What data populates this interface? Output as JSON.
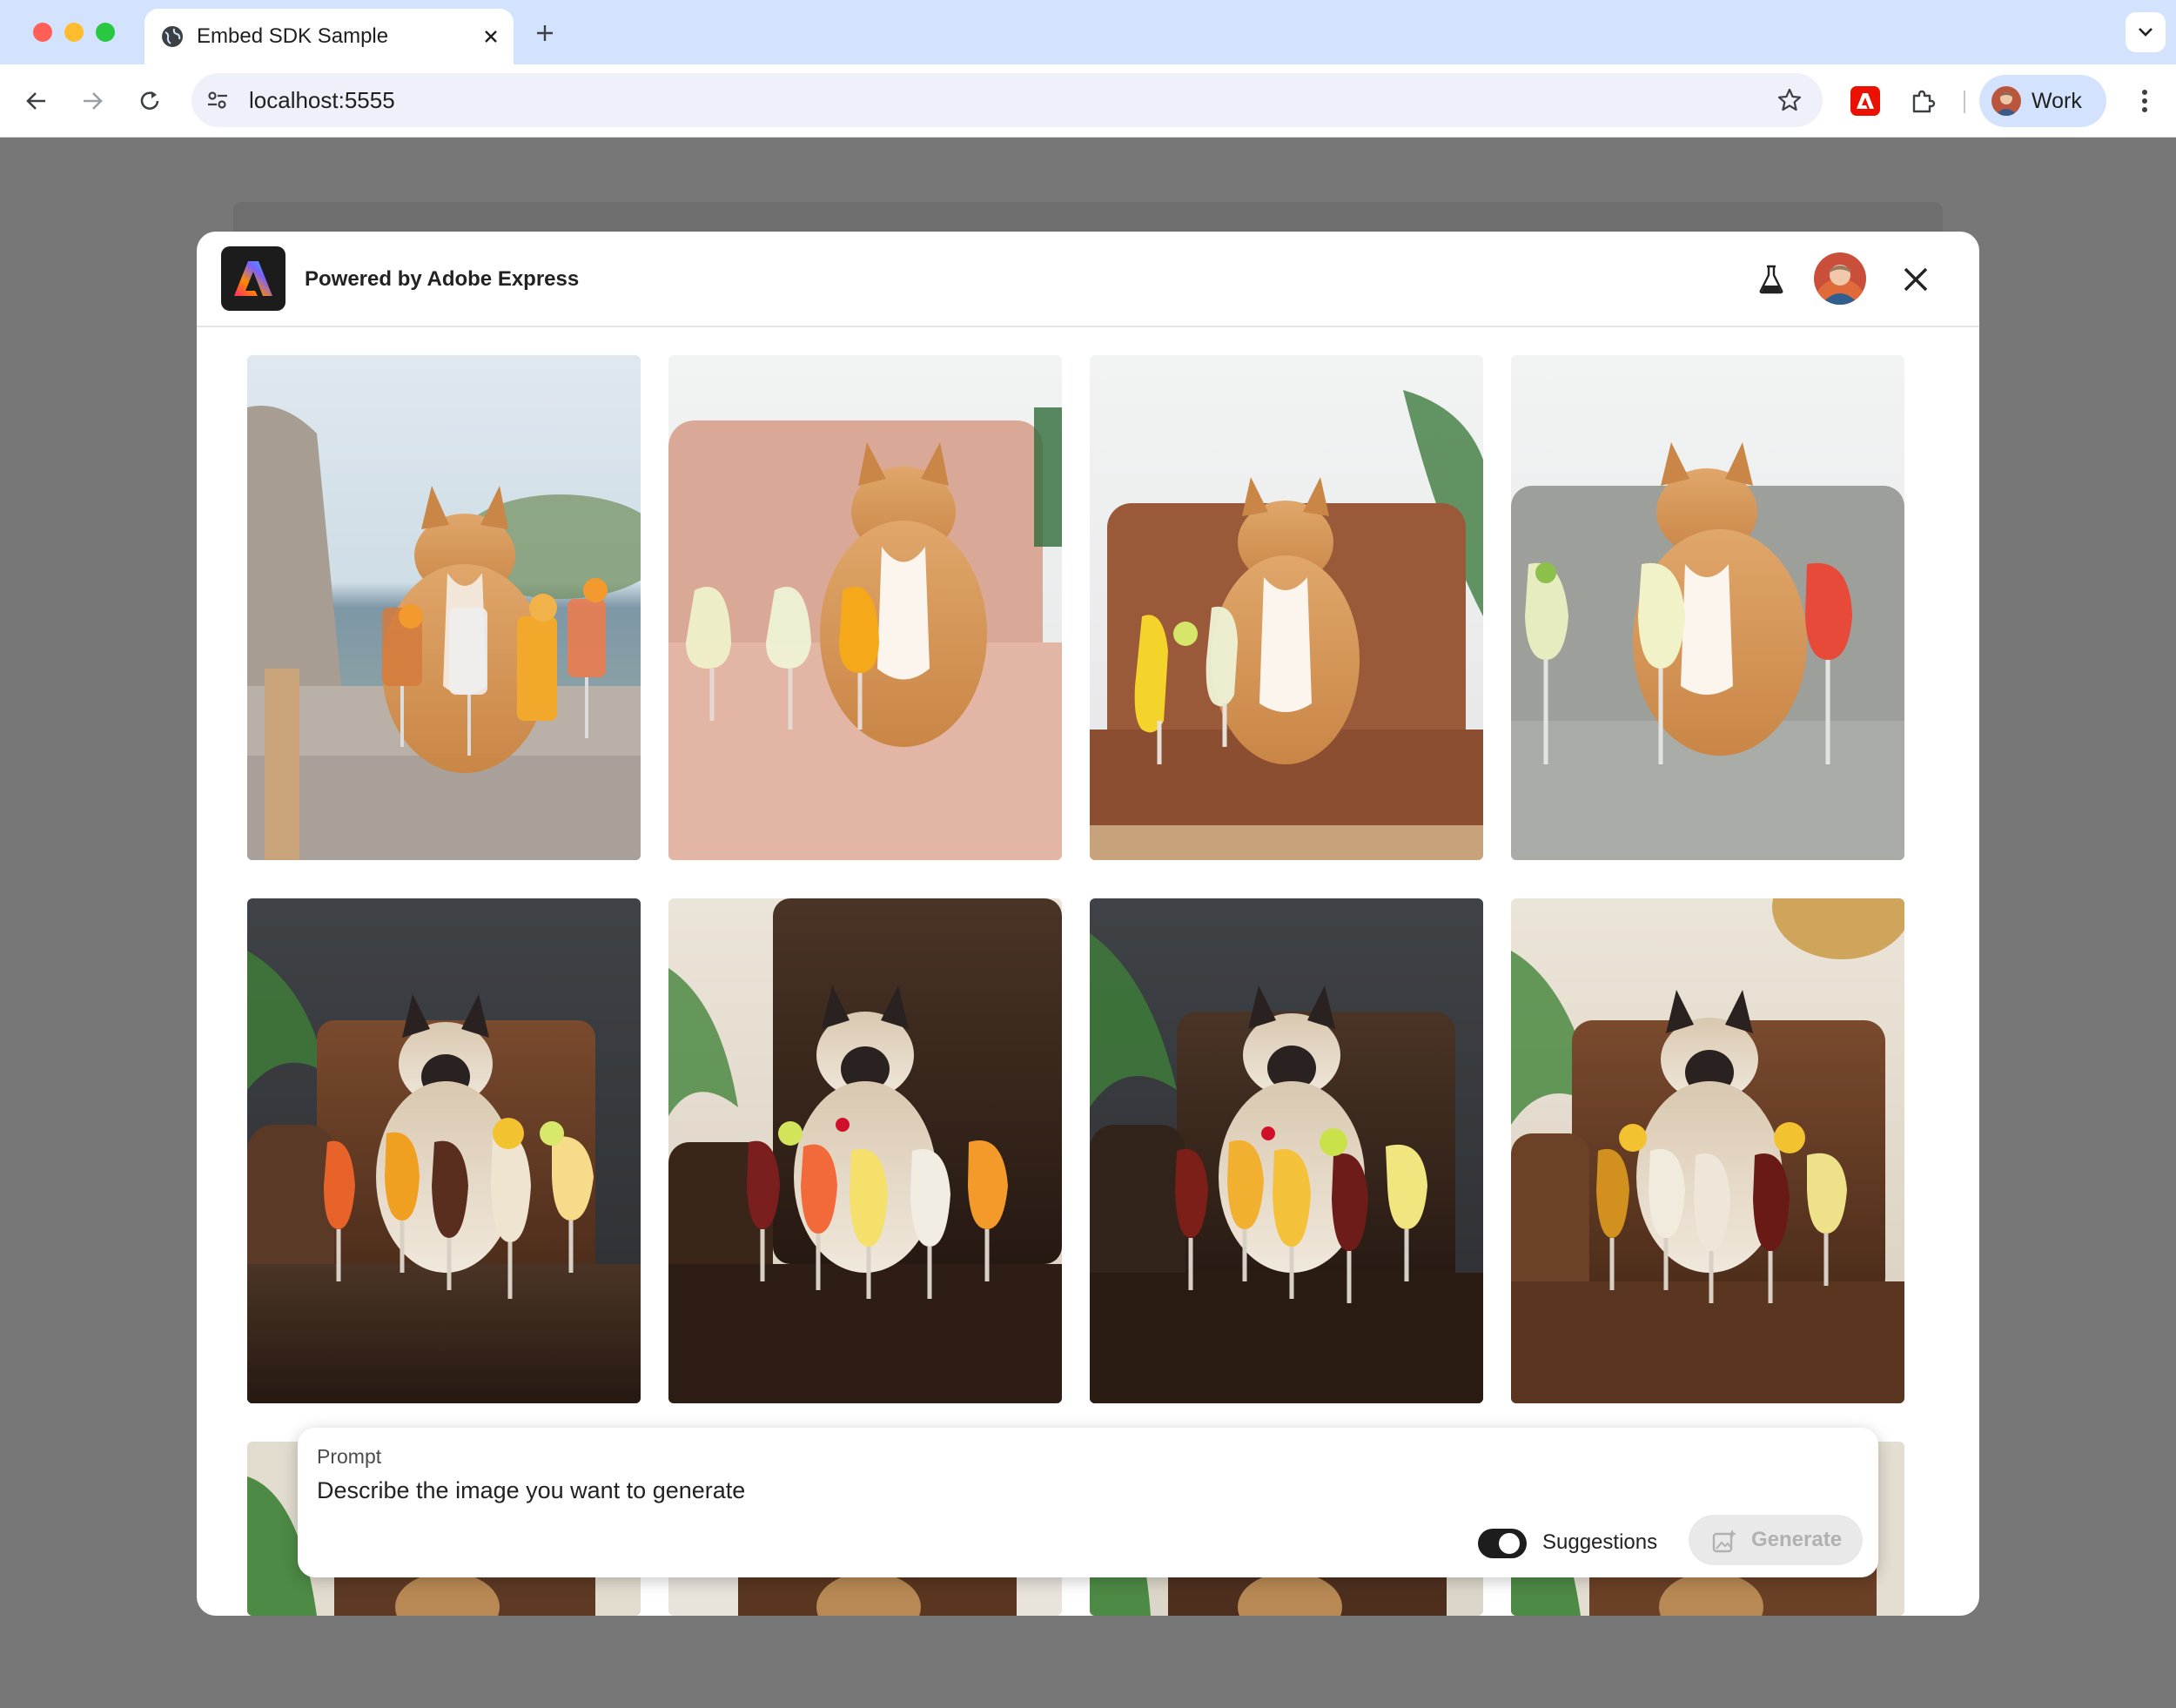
{
  "browser": {
    "tab_title": "Embed SDK Sample",
    "url": "localhost:5555",
    "profile_name": "Work"
  },
  "modal": {
    "title": "Powered by Adobe Express"
  },
  "gallery": {
    "rows": [
      {
        "items": [
          {
            "subject": "orange tabby cat",
            "scene": "beige armchair, seaside"
          },
          {
            "subject": "orange tabby cat",
            "scene": "pink leather armchair"
          },
          {
            "subject": "orange tabby cat",
            "scene": "brown leather armchair, palm"
          },
          {
            "subject": "orange tabby cat",
            "scene": "grey sofa"
          }
        ]
      },
      {
        "items": [
          {
            "subject": "siamese cat",
            "scene": "dark leather chair, palm"
          },
          {
            "subject": "siamese cat",
            "scene": "dark tufted leather chair"
          },
          {
            "subject": "siamese cat",
            "scene": "dark leather chair, palm"
          },
          {
            "subject": "siamese cat",
            "scene": "brown leather chair, hat"
          }
        ]
      },
      {
        "items": [
          {
            "subject": "bengal cat",
            "scene": "leather chair"
          },
          {
            "subject": "bengal cat",
            "scene": "leather chair"
          },
          {
            "subject": "bengal cat",
            "scene": "leather chair"
          },
          {
            "subject": "bengal cat",
            "scene": "leather chair"
          }
        ]
      }
    ]
  },
  "prompt": {
    "label": "Prompt",
    "placeholder": "Describe the image you want to generate",
    "suggestions_label": "Suggestions",
    "suggestions_on": true,
    "generate_label": "Generate"
  },
  "icons": {
    "tab": "globe-icon",
    "tab_close": "close-icon",
    "new_tab": "plus-icon",
    "tab_search": "chevron-down-icon",
    "back": "arrow-left-icon",
    "forward": "arrow-right-icon",
    "reload": "reload-icon",
    "site_info": "tune-icon",
    "bookmark": "star-icon",
    "ext_adobe": "adobe-icon",
    "extensions": "puzzle-icon",
    "menu": "kebab-icon",
    "labs": "flask-icon",
    "modal_close": "close-icon",
    "generate": "image-sparkle-icon"
  },
  "colors": {
    "tabbar": "#d3e3fd",
    "backdrop": "#777777",
    "adobe_red": "#eb1000",
    "toggle_on": "#1d1d1d"
  }
}
